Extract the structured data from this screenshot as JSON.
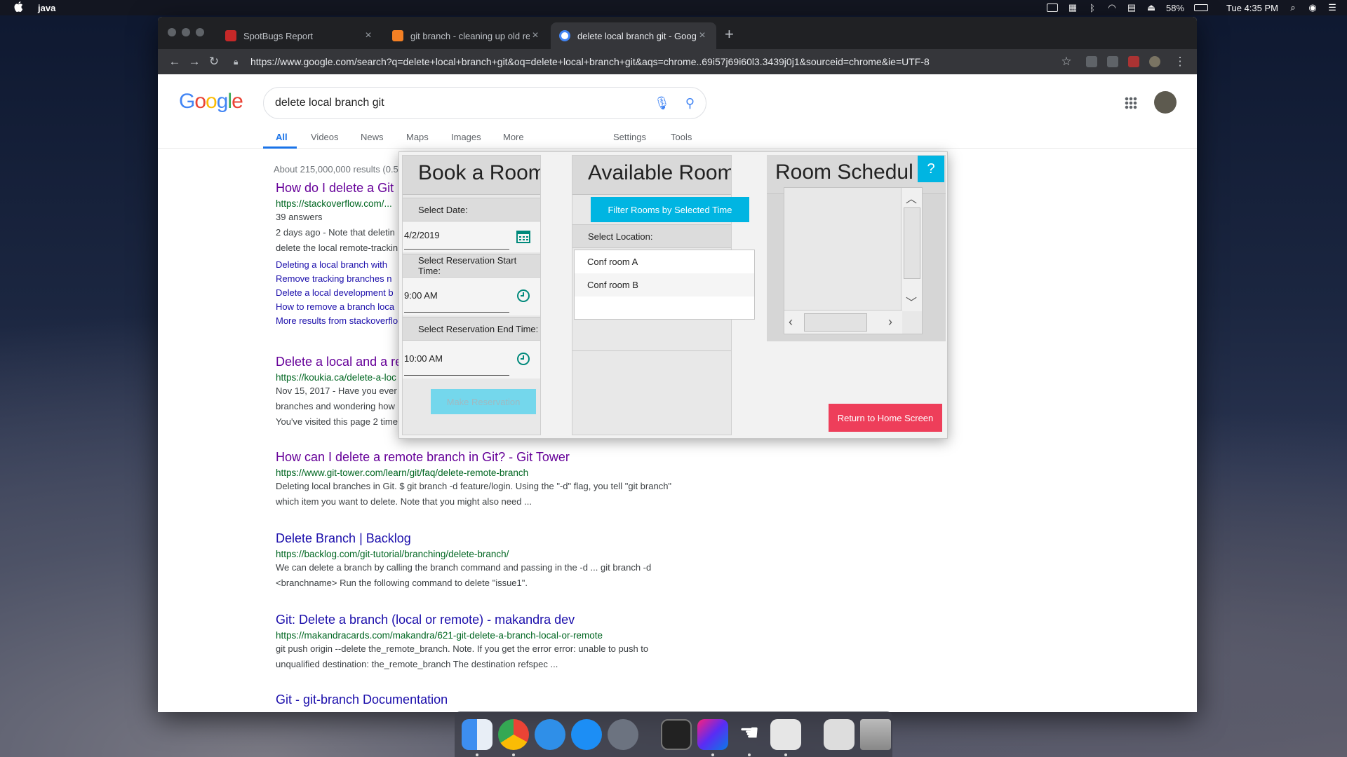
{
  "menubar": {
    "app_name": "java",
    "battery": "58%",
    "clock": "Tue 4:35 PM"
  },
  "browser": {
    "tabs": [
      {
        "title": "SpotBugs Report",
        "favicon_color": "#c62828"
      },
      {
        "title": "git branch - cleaning up old re",
        "favicon_color": "#f48024"
      },
      {
        "title": "delete local branch git - Googl",
        "favicon_color": "#4285f4"
      }
    ],
    "url": "https://www.google.com/search?q=delete+local+branch+git&oq=delete+local+branch+git&aqs=chrome..69i57j69i60l3.3439j0j1&sourceid=chrome&ie=UTF-8",
    "url_domain": "https://www.google.com"
  },
  "google": {
    "logo": [
      "G",
      "o",
      "o",
      "g",
      "l",
      "e"
    ],
    "query": "delete local branch git",
    "tabs": [
      "All",
      "Videos",
      "News",
      "Maps",
      "Images",
      "More",
      "Settings",
      "Tools"
    ],
    "stats": "About 215,000,000 results (0.5",
    "results": [
      {
        "title": "How do I delete a Git",
        "url": "https://stackoverflow.com/...",
        "meta": "39 answers",
        "snippet1": "2 days ago - Note that deletin",
        "snippet2": "delete the local remote-trackin",
        "sublinks": [
          "Deleting a local branch with",
          "Remove tracking branches n",
          "Delete a local development b",
          "How to remove a branch loca",
          "More results from stackoverflo"
        ]
      },
      {
        "title": "Delete a local and a re",
        "url": "https://koukia.ca/delete-a-loc",
        "snippet1": "Nov 15, 2017 - Have you ever",
        "snippet2": "branches and wondering how",
        "snippet3": "You've visited this page 2 time"
      },
      {
        "title": "How can I delete a remote branch in Git? - Git Tower",
        "url": "https://www.git-tower.com/learn/git/faq/delete-remote-branch",
        "snippet1": "Deleting local branches in Git. $ git branch -d feature/login. Using the \"-d\" flag, you tell \"git branch\"",
        "snippet2": "which item you want to delete. Note that you might also need ..."
      },
      {
        "title": "Delete Branch | Backlog",
        "url": "https://backlog.com/git-tutorial/branching/delete-branch/",
        "snippet1": "We can delete a branch by calling the branch command and passing in the -d ... git branch -d",
        "snippet2": "<branchname> Run the following command to delete \"issue1\"."
      },
      {
        "title": "Git: Delete a branch (local or remote) - makandra dev",
        "url": "https://makandracards.com/makandra/621-git-delete-a-branch-local-or-remote",
        "snippet1": "git push origin --delete the_remote_branch. Note. If you get the error error: unable to push to",
        "snippet2": "unqualified destination: the_remote_branch The destination refspec ..."
      },
      {
        "title": "Git - git-branch Documentation"
      }
    ]
  },
  "app": {
    "book": {
      "header": "Book a Room",
      "date_label": "Select Date:",
      "date_value": "4/2/2019",
      "start_label": "Select Reservation Start Time:",
      "start_value": "9:00 AM",
      "end_label": "Select Reservation End Time:",
      "end_value": "10:00 AM",
      "make_button": "Make Reservation"
    },
    "rooms": {
      "header": "Available Rooms",
      "filter_button": "Filter Rooms by Selected Time",
      "location_label": "Select Location:",
      "items": [
        "Conf room A",
        "Conf room B"
      ]
    },
    "schedule": {
      "header": "Room Schedul",
      "help": "?",
      "home_button": "Return to Home Screen"
    },
    "colors": {
      "accent": "#00b5e2",
      "danger": "#ee3e5a",
      "icon": "#00897b"
    }
  }
}
